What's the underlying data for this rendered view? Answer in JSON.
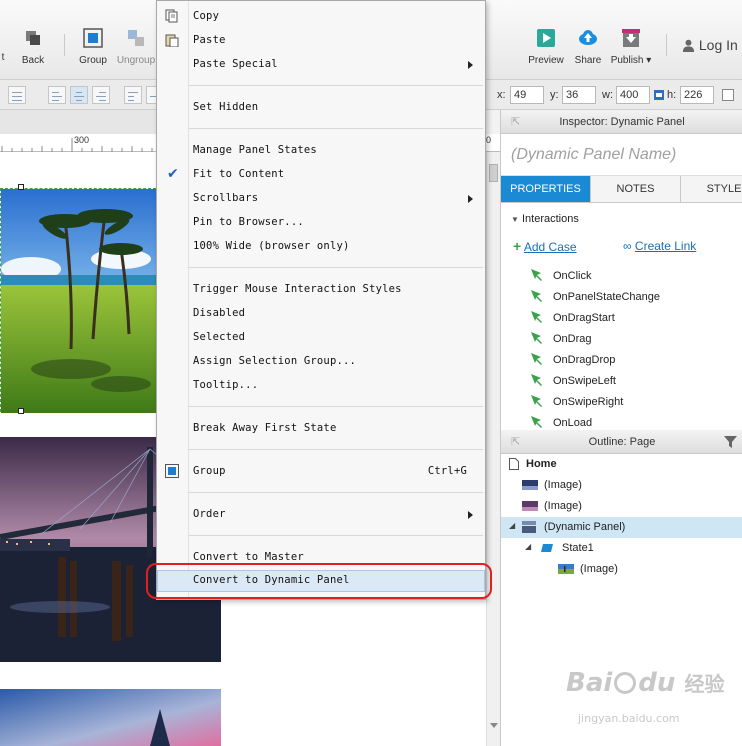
{
  "toolbar": {
    "left_cut_label": "t",
    "back_label": "Back",
    "group_label": "Group",
    "ungroup_label": "Ungroup",
    "preview_label": "Preview",
    "share_label": "Share",
    "publish_label": "Publish ▾",
    "login_label": "Log In"
  },
  "geometry_fields": {
    "x_label": "x:",
    "x_value": "49",
    "y_label": "y:",
    "y_value": "36",
    "w_label": "w:",
    "w_value": "400",
    "h_label": "h:",
    "h_value": "226"
  },
  "ruler": {
    "mark_300": "300",
    "mark_right": "0"
  },
  "context_menu": {
    "copy": "Copy",
    "paste": "Paste",
    "paste_special": "Paste Special",
    "set_hidden": "Set Hidden",
    "manage_panel_states": "Manage Panel States",
    "fit_to_content": "Fit to Content",
    "scrollbars": "Scrollbars",
    "pin_to_browser": "Pin to Browser...",
    "wide_100": "100% Wide (browser only)",
    "trigger_mouse": "Trigger Mouse Interaction Styles",
    "disabled": "Disabled",
    "selected": "Selected",
    "assign_selection_group": "Assign Selection Group...",
    "tooltip": "Tooltip...",
    "break_away": "Break Away First State",
    "group": "Group",
    "group_shortcut": "Ctrl+G",
    "order": "Order",
    "convert_master": "Convert to Master",
    "convert_dynamic_panel": "Convert to Dynamic Panel"
  },
  "inspector": {
    "header": "Inspector: Dynamic Panel",
    "name_placeholder": "(Dynamic Panel Name)",
    "tabs": [
      "PROPERTIES",
      "NOTES",
      "STYLE"
    ],
    "interactions_label": "Interactions",
    "add_case": "Add Case",
    "create_link": "Create Link",
    "events": [
      "OnClick",
      "OnPanelStateChange",
      "OnDragStart",
      "OnDrag",
      "OnDragDrop",
      "OnSwipeLeft",
      "OnSwipeRight",
      "OnLoad"
    ]
  },
  "outline": {
    "header": "Outline: Page",
    "items": [
      "Home",
      "(Image)",
      "(Image)",
      "(Dynamic Panel)",
      "State1",
      "(Image)"
    ]
  },
  "watermark": {
    "brand": "Bai",
    "brand2": "du",
    "sub": "经验",
    "url": "jingyan.baidu.com"
  },
  "colors": {
    "accent": "#1a7fd4",
    "highlight_box": "#e02020",
    "selection": "#cfe6f5"
  }
}
